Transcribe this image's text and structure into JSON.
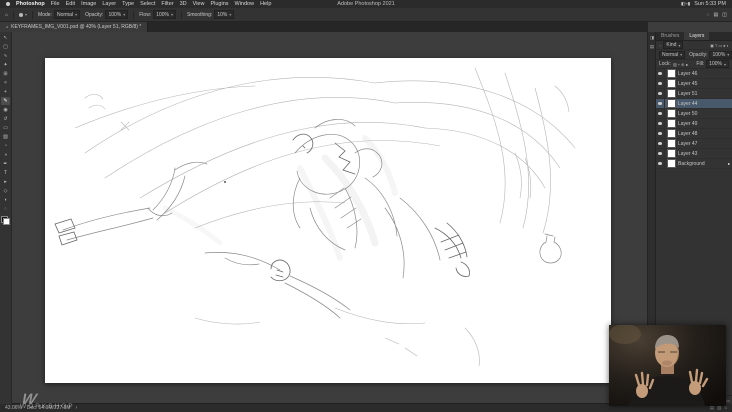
{
  "menubar": {
    "app_name": "Photoshop",
    "items": [
      "File",
      "Edit",
      "Image",
      "Layer",
      "Type",
      "Select",
      "Filter",
      "3D",
      "View",
      "Plugins",
      "Window",
      "Help"
    ],
    "window_title": "Adobe Photoshop 2021",
    "time": "Sun 5:33 PM",
    "status_icons": [
      {
        "name": "control-center-icon",
        "glyph": "◧"
      },
      {
        "name": "wifi-icon",
        "glyph": "≈"
      },
      {
        "name": "battery-icon",
        "glyph": "▮"
      }
    ]
  },
  "options_bar": {
    "home_glyph": "⌂",
    "caret": "▾",
    "mode_label": "Mode:",
    "mode_value": "Normal",
    "opacity_label": "Opacity:",
    "opacity_value": "100%",
    "flow_label": "Flow:",
    "flow_value": "100%",
    "smoothing_label": "Smoothing:",
    "smoothing_value": "10%",
    "right_icons": [
      {
        "name": "search-icon",
        "glyph": "◌"
      },
      {
        "name": "workspace-switcher-icon",
        "glyph": "▤"
      },
      {
        "name": "arrange-documents-icon",
        "glyph": "◫"
      }
    ]
  },
  "document": {
    "tab_dot": "●",
    "tab_title": "KEYFRAMES_IMG_V001.psd @ 43% (Layer 51, RGB/8) *",
    "zoom_level": "43.06%",
    "doc_size": "Doc: 54.9M/227.5M",
    "status_chevron": "›"
  },
  "tools": [
    {
      "name": "move-tool",
      "glyph": "↖"
    },
    {
      "name": "marquee-tool",
      "glyph": "▢"
    },
    {
      "name": "lasso-tool",
      "glyph": "∿"
    },
    {
      "name": "quick-selection-tool",
      "glyph": "✦"
    },
    {
      "name": "crop-tool",
      "glyph": "⊞"
    },
    {
      "name": "eyedropper-tool",
      "glyph": "✧"
    },
    {
      "name": "healing-brush-tool",
      "glyph": "+"
    },
    {
      "name": "brush-tool",
      "glyph": "✎",
      "active": true
    },
    {
      "name": "clone-stamp-tool",
      "glyph": "◉"
    },
    {
      "name": "history-brush-tool",
      "glyph": "↺"
    },
    {
      "name": "eraser-tool",
      "glyph": "▭"
    },
    {
      "name": "gradient-tool",
      "glyph": "▨"
    },
    {
      "name": "blur-tool",
      "glyph": "◔"
    },
    {
      "name": "dodge-tool",
      "glyph": "◑"
    },
    {
      "name": "pen-tool",
      "glyph": "✒"
    },
    {
      "name": "type-tool",
      "glyph": "T"
    },
    {
      "name": "path-selection-tool",
      "glyph": "▸"
    },
    {
      "name": "shape-tool",
      "glyph": "◇"
    },
    {
      "name": "hand-tool",
      "glyph": "◖"
    },
    {
      "name": "zoom-tool",
      "glyph": "◌"
    }
  ],
  "panels": {
    "tabs": [
      {
        "label": "Brushes"
      },
      {
        "label": "Layers",
        "active": true
      }
    ],
    "search_glyph": "◌",
    "kind_label": "Kind",
    "caret": "▾",
    "filter_icons": [
      {
        "name": "filter-pixel-layers-icon",
        "glyph": "▣"
      },
      {
        "name": "filter-type-layers-icon",
        "glyph": "T"
      },
      {
        "name": "filter-shape-layers-icon",
        "glyph": "▭"
      },
      {
        "name": "filter-smart-objects-icon",
        "glyph": "●"
      },
      {
        "name": "filter-attributes-icon",
        "glyph": "◐"
      }
    ],
    "blend_mode": "Normal",
    "opacity_label": "Opacity:",
    "opacity_value": "100%",
    "lock_label": "Lock:",
    "lock_icons": [
      {
        "name": "lock-transparency-icon",
        "glyph": "▨"
      },
      {
        "name": "lock-pixels-icon",
        "glyph": "+"
      },
      {
        "name": "lock-position-icon",
        "glyph": "⊕"
      },
      {
        "name": "lock-all-icon",
        "glyph": "∎"
      }
    ],
    "fill_label": "Fill:",
    "fill_value": "100%",
    "layers": [
      {
        "name": "Layer 46"
      },
      {
        "name": "Layer 45"
      },
      {
        "name": "Layer 51"
      },
      {
        "name": "Layer 44",
        "selected": true
      },
      {
        "name": "Layer 50"
      },
      {
        "name": "Layer 49"
      },
      {
        "name": "Layer 48"
      },
      {
        "name": "Layer 47"
      },
      {
        "name": "Layer 43"
      },
      {
        "name": "Background",
        "locked": true
      }
    ],
    "footer_icons": [
      {
        "name": "link-layers-icon",
        "glyph": "▥"
      },
      {
        "name": "layer-effects-icon",
        "glyph": "fx"
      },
      {
        "name": "layer-mask-icon",
        "glyph": "◐"
      },
      {
        "name": "adjustment-layer-icon",
        "glyph": "◑"
      },
      {
        "name": "layer-group-icon",
        "glyph": "▢"
      },
      {
        "name": "new-layer-icon",
        "glyph": "+"
      },
      {
        "name": "delete-layer-icon",
        "glyph": "▭"
      }
    ],
    "dock_icons": [
      {
        "name": "collapsed-color-panel-icon",
        "glyph": "◨"
      },
      {
        "name": "collapsed-properties-panel-icon",
        "glyph": "▤"
      }
    ]
  },
  "statusbar_icons": [
    {
      "name": "status-extra-icon",
      "glyph": "▤"
    },
    {
      "name": "status-grid-icon",
      "glyph": "▥"
    },
    {
      "name": "status-menu-icon",
      "glyph": "≡"
    }
  ],
  "watermark": {
    "mark": "W",
    "text": "WORKSHOP"
  }
}
